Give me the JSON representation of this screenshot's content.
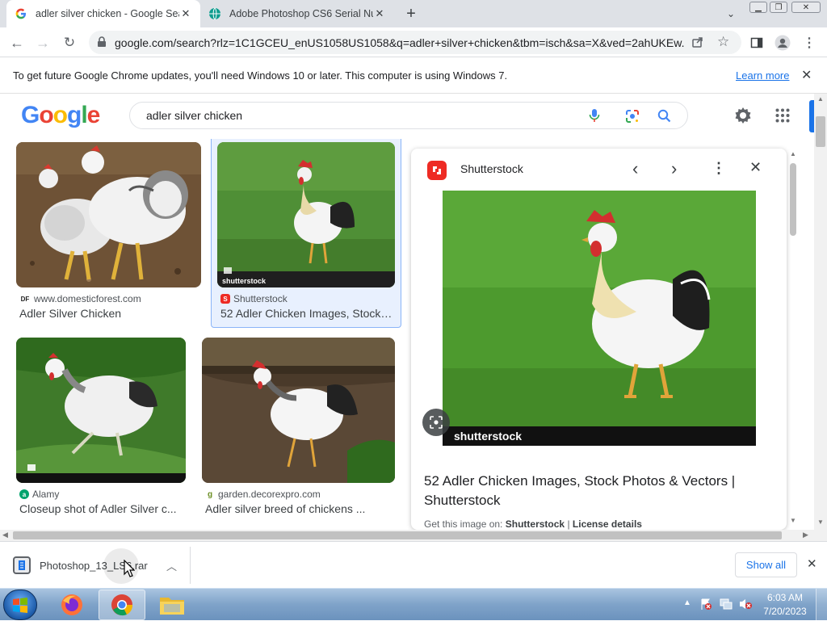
{
  "tabs": [
    {
      "title": "adler silver chicken - Google Sea",
      "favicon": "google-g-icon",
      "active": true
    },
    {
      "title": "Adobe Photoshop CS6 Serial Nu",
      "favicon": "globe-icon",
      "active": false
    }
  ],
  "address_bar": {
    "url": "google.com/search?rlz=1C1GCEU_enUS1058US1058&q=adler+silver+chicken&tbm=isch&sa=X&ved=2ahUKEw..."
  },
  "infobar": {
    "message": "To get future Google Chrome updates, you'll need Windows 10 or later. This computer is using Windows 7.",
    "link": "Learn more"
  },
  "google": {
    "logo": "Google",
    "query": "adler silver chicken"
  },
  "results": [
    {
      "source_icon": "DF",
      "source": "www.domesticforest.com",
      "caption": "Adler Silver Chicken"
    },
    {
      "source_icon": "S",
      "source": "Shutterstock",
      "caption": "52 Adler Chicken Images, Stock…",
      "watermark": "shutterstock"
    },
    {
      "source_icon": "a",
      "source": "Alamy",
      "caption": "Closeup shot of Adler Silver c..."
    },
    {
      "source_icon": "g",
      "source": "garden.decorexpro.com",
      "caption": "Adler silver breed of chickens ..."
    }
  ],
  "panel": {
    "source": "Shutterstock",
    "watermark": "shutterstock",
    "title": "52 Adler Chicken Images, Stock Photos & Vectors | Shutterstock",
    "get_image_prefix": "Get this image on:",
    "get_image_source": "Shutterstock",
    "separator": "|",
    "license": "License details"
  },
  "download": {
    "filename": "Photoshop_13_LS6.rar",
    "show_all": "Show all"
  },
  "taskbar": {
    "time": "6:03 AM",
    "date": "7/20/2023"
  },
  "colors": {
    "google_blue": "#4285f4",
    "link_blue": "#1a0dab",
    "shutterstock_red": "#ee2b24"
  }
}
